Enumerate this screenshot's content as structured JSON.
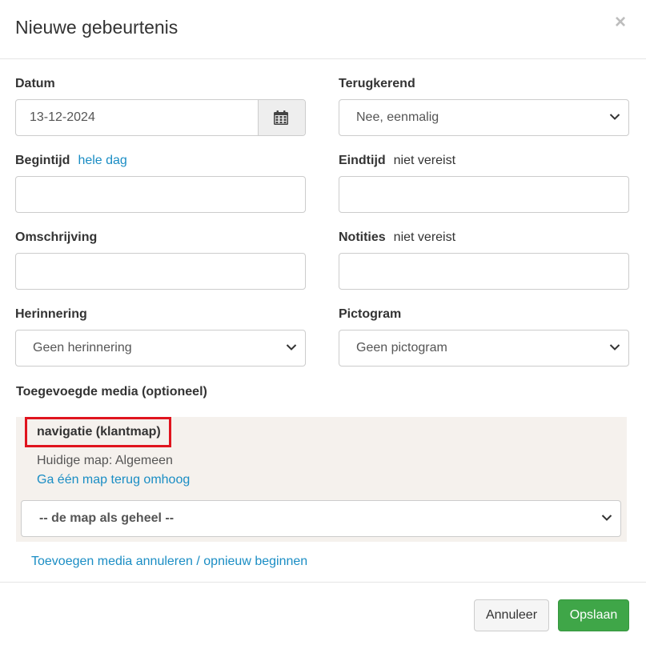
{
  "modal": {
    "title": "Nieuwe gebeurtenis",
    "close_symbol": "×"
  },
  "date": {
    "label": "Datum",
    "value": "13-12-2024",
    "icon": "calendar-icon"
  },
  "recurring": {
    "label": "Terugkerend",
    "selected": "Nee, eenmalig"
  },
  "start_time": {
    "label": "Begintijd",
    "link": "hele dag",
    "value": ""
  },
  "end_time": {
    "label": "Eindtijd",
    "suffix": "niet vereist",
    "value": ""
  },
  "description": {
    "label": "Omschrijving",
    "value": ""
  },
  "notes": {
    "label": "Notities",
    "suffix": "niet vereist",
    "value": ""
  },
  "reminder": {
    "label": "Herinnering",
    "selected": "Geen herinnering"
  },
  "pictogram": {
    "label": "Pictogram",
    "selected": "Geen pictogram"
  },
  "media": {
    "section_title": "Toegevoegde media (optioneel)",
    "folder_name": "navigatie (klantmap)",
    "current_folder": "Huidige map: Algemeen",
    "up_link": "Ga één map terug omhoog",
    "folder_select": "-- de map als geheel --",
    "cancel_link": "Toevoegen media annuleren / opnieuw beginnen",
    "highlight_color": "#e0141e"
  },
  "footer": {
    "cancel_label": "Annuleer",
    "save_label": "Opslaan",
    "save_color": "#3fa648"
  }
}
